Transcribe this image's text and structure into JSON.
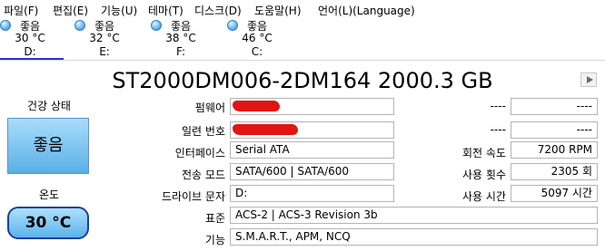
{
  "menu": {
    "items": [
      "파일(F)",
      "편집(E)",
      "기능(U)",
      "테마(T)",
      "디스크(D)",
      "도움말(H)",
      "언어(L)(Language)"
    ]
  },
  "disks": [
    {
      "status": "좋음",
      "temp": "30 °C",
      "letter": "D:"
    },
    {
      "status": "좋음",
      "temp": "32 °C",
      "letter": "E:"
    },
    {
      "status": "좋음",
      "temp": "38 °C",
      "letter": "F:"
    },
    {
      "status": "좋음",
      "temp": "46 °C",
      "letter": "C:"
    }
  ],
  "model_title": "ST2000DM006-2DM164 2000.3 GB",
  "health": {
    "label": "건강 상태",
    "value": "좋음"
  },
  "temperature": {
    "label": "온도",
    "value": "30 °C"
  },
  "info": {
    "firmware": {
      "label": "펌웨어",
      "value": ""
    },
    "serial": {
      "label": "일련 번호",
      "value": ""
    },
    "interface": {
      "label": "인터페이스",
      "value": "Serial ATA"
    },
    "transfer": {
      "label": "전송 모드",
      "value": "SATA/600 | SATA/600"
    },
    "drive_letter": {
      "label": "드라이브 문자",
      "value": "D:"
    },
    "standard": {
      "label": "표준",
      "value": "ACS-2 | ACS-3 Revision 3b"
    },
    "features": {
      "label": "기능",
      "value": "S.M.A.R.T., APM, NCQ"
    }
  },
  "right_info": {
    "row1": {
      "label": "----",
      "value": "----"
    },
    "row2": {
      "label": "----",
      "value": "----"
    },
    "rotation": {
      "label": "회전 속도",
      "value": "7200 RPM"
    },
    "power_count": {
      "label": "사용 횟수",
      "value": "2305 회"
    },
    "power_hours": {
      "label": "사용 시간",
      "value": "5097 시간"
    }
  },
  "colors": {
    "health_good": "#7ec4f0",
    "temp_border": "#1a3fa5",
    "selected_disk_underline": "#2f2fcf",
    "redaction": "#e21414"
  }
}
